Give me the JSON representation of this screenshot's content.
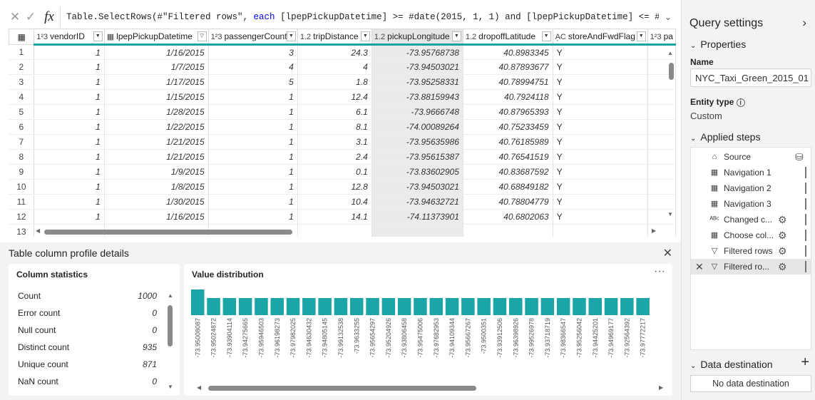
{
  "formula_bar": {
    "text_pre": "Table.SelectRows(#\"Filtered rows\", ",
    "keyword": "each",
    "text_post": " [lpepPickupDatetime] >= #date(2015, 1, 1) and [lpepPickupDatetime] <= #date",
    "cancel_glyph": "✕",
    "confirm_glyph": "✓",
    "fx_label": "fx"
  },
  "grid": {
    "columns": [
      {
        "type_icon": "1²3",
        "name": "vendorID"
      },
      {
        "type_icon": "▦",
        "name": "lpepPickupDatetime",
        "filtered": true
      },
      {
        "type_icon": "1²3",
        "name": "passengerCount"
      },
      {
        "type_icon": "1.2",
        "name": "tripDistance"
      },
      {
        "type_icon": "1.2",
        "name": "pickupLongitude",
        "selected": true
      },
      {
        "type_icon": "1.2",
        "name": "dropoffLatitude"
      },
      {
        "type_icon": "A᷊C",
        "name": "storeAndFwdFlag"
      },
      {
        "type_icon": "1²3",
        "name": "pa"
      }
    ],
    "rows": [
      [
        "1",
        "1",
        "1/16/2015",
        "3",
        "24.3",
        "-73.95768738",
        "40.8983345",
        "Y"
      ],
      [
        "2",
        "1",
        "1/7/2015",
        "4",
        "4",
        "-73.94503021",
        "40.87893677",
        "Y"
      ],
      [
        "3",
        "1",
        "1/17/2015",
        "5",
        "1.8",
        "-73.95258331",
        "40.78994751",
        "Y"
      ],
      [
        "4",
        "1",
        "1/15/2015",
        "1",
        "12.4",
        "-73.88159943",
        "40.7924118",
        "Y"
      ],
      [
        "5",
        "1",
        "1/28/2015",
        "1",
        "6.1",
        "-73.9666748",
        "40.87965393",
        "Y"
      ],
      [
        "6",
        "1",
        "1/22/2015",
        "1",
        "8.1",
        "-74.00089264",
        "40.75233459",
        "Y"
      ],
      [
        "7",
        "1",
        "1/21/2015",
        "1",
        "3.1",
        "-73.95635986",
        "40.76185989",
        "Y"
      ],
      [
        "8",
        "1",
        "1/21/2015",
        "1",
        "2.4",
        "-73.95615387",
        "40.76541519",
        "Y"
      ],
      [
        "9",
        "1",
        "1/9/2015",
        "1",
        "0.1",
        "-73.83602905",
        "40.83687592",
        "Y"
      ],
      [
        "10",
        "1",
        "1/8/2015",
        "1",
        "12.8",
        "-73.94503021",
        "40.68849182",
        "Y"
      ],
      [
        "11",
        "1",
        "1/30/2015",
        "1",
        "10.4",
        "-73.94632721",
        "40.78804779",
        "Y"
      ],
      [
        "12",
        "1",
        "1/16/2015",
        "1",
        "14.1",
        "-74.11373901",
        "40.6802063",
        "Y"
      ],
      [
        "13",
        "",
        "",
        "",
        "",
        "",
        "",
        ""
      ]
    ]
  },
  "profile": {
    "title": "Table column profile details",
    "close_glyph": "✕",
    "stats_title": "Column statistics",
    "stats": [
      {
        "label": "Count",
        "value": "1000"
      },
      {
        "label": "Error count",
        "value": "0"
      },
      {
        "label": "Null count",
        "value": "0"
      },
      {
        "label": "Distinct count",
        "value": "935"
      },
      {
        "label": "Unique count",
        "value": "871"
      },
      {
        "label": "NaN count",
        "value": "0"
      }
    ],
    "dist_title": "Value distribution",
    "more_glyph": "···"
  },
  "chart_data": {
    "type": "bar",
    "title": "Value distribution",
    "categories": [
      "-73.95008087",
      "-73.95024872",
      "-73.93904114",
      "-73.94275665",
      "-73.95946503",
      "-73.96198273",
      "-73.97982025",
      "-73.94630432",
      "-73.94805145",
      "-73.99132538",
      "-73.9633255",
      "-73.95654297",
      "-73.95204926",
      "-73.93806458",
      "-73.95475006",
      "-73.97682953",
      "-73.94109344",
      "-73.95667267",
      "-73.9500351",
      "-73.93912506",
      "-73.96398926",
      "-73.99526978",
      "-73.93718719",
      "-73.98366547",
      "-73.95256042",
      "-73.94425201",
      "-73.94969177",
      "-73.92564392",
      "-73.97772217"
    ],
    "values": [
      3,
      2,
      2,
      2,
      2,
      2,
      2,
      2,
      2,
      2,
      2,
      2,
      2,
      2,
      2,
      2,
      2,
      2,
      2,
      2,
      2,
      2,
      2,
      2,
      2,
      2,
      2,
      2,
      2
    ],
    "ylim": [
      0,
      3
    ],
    "bar_color": "#1aa6a6"
  },
  "query_settings": {
    "title": "Query settings",
    "collapse_glyph": "›",
    "properties_label": "Properties",
    "name_label": "Name",
    "name_value": "NYC_Taxi_Green_2015_01",
    "entity_type_label": "Entity type",
    "entity_type_value": "Custom",
    "applied_steps_label": "Applied steps",
    "steps": [
      {
        "label": "Source",
        "icon": "source-icon",
        "glyph": "⌂",
        "gear": false,
        "bar": false
      },
      {
        "label": "Navigation 1",
        "icon": "table-icon",
        "glyph": "▦",
        "gear": false,
        "bar": true
      },
      {
        "label": "Navigation 2",
        "icon": "table-icon",
        "glyph": "▦",
        "gear": false,
        "bar": true
      },
      {
        "label": "Navigation 3",
        "icon": "table-icon",
        "glyph": "▦",
        "gear": false,
        "bar": true
      },
      {
        "label": "Changed c...",
        "icon": "changed-type-icon",
        "glyph": "ᴬᴮᶜ",
        "gear": true,
        "bar": true
      },
      {
        "label": "Choose col...",
        "icon": "choose-columns-icon",
        "glyph": "▦",
        "gear": true,
        "bar": true
      },
      {
        "label": "Filtered rows",
        "icon": "filter-icon",
        "glyph": "▽",
        "gear": true,
        "bar": true
      },
      {
        "label": "Filtered ro...",
        "icon": "filter-icon",
        "glyph": "▽",
        "gear": true,
        "bar": true,
        "active": true
      }
    ],
    "data_destination_label": "Data destination",
    "data_destination_value": "No data destination",
    "add_glyph": "+"
  }
}
